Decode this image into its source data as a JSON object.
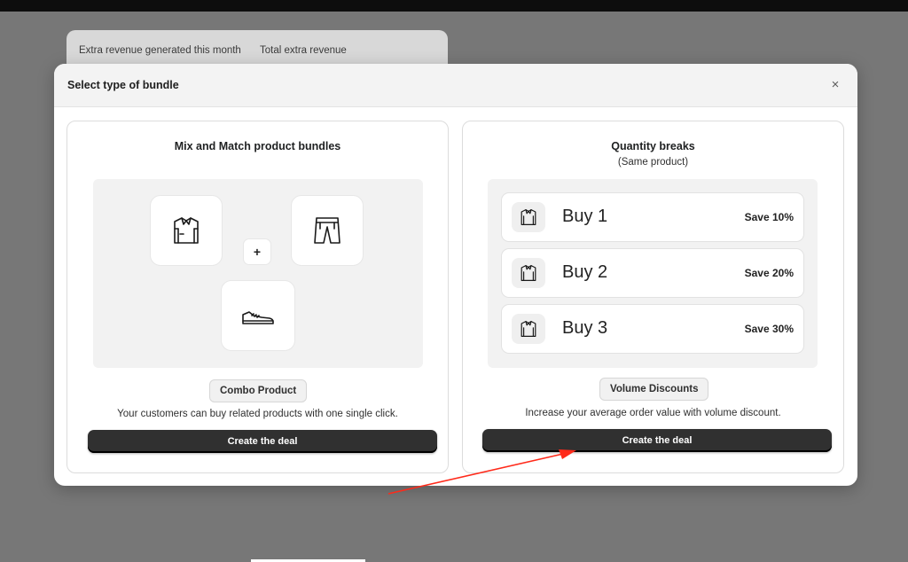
{
  "background": {
    "stats": [
      "Extra revenue generated this month",
      "Total extra revenue"
    ]
  },
  "modal": {
    "title": "Select type of bundle",
    "close_glyph": "×"
  },
  "bundles": [
    {
      "title": "Mix and Match product bundles",
      "items": [
        "shirt-icon",
        "pants-icon",
        "shoe-icon"
      ],
      "plus_glyph": "+",
      "badge": "Combo Product",
      "description": "Your customers can buy related products with one single click.",
      "cta": "Create the deal"
    },
    {
      "title": "Quantity breaks",
      "subtitle": "(Same product)",
      "tiers": [
        {
          "label": "Buy 1",
          "save": "Save 10%"
        },
        {
          "label": "Buy 2",
          "save": "Save 20%"
        },
        {
          "label": "Buy 3",
          "save": "Save 30%"
        }
      ],
      "badge": "Volume Discounts",
      "description": "Increase your average order value with volume discount.",
      "cta": "Create the deal"
    }
  ],
  "colors": {
    "overlay": "#777777",
    "button": "#303030",
    "annotation_arrow": "#ff2a1a"
  }
}
